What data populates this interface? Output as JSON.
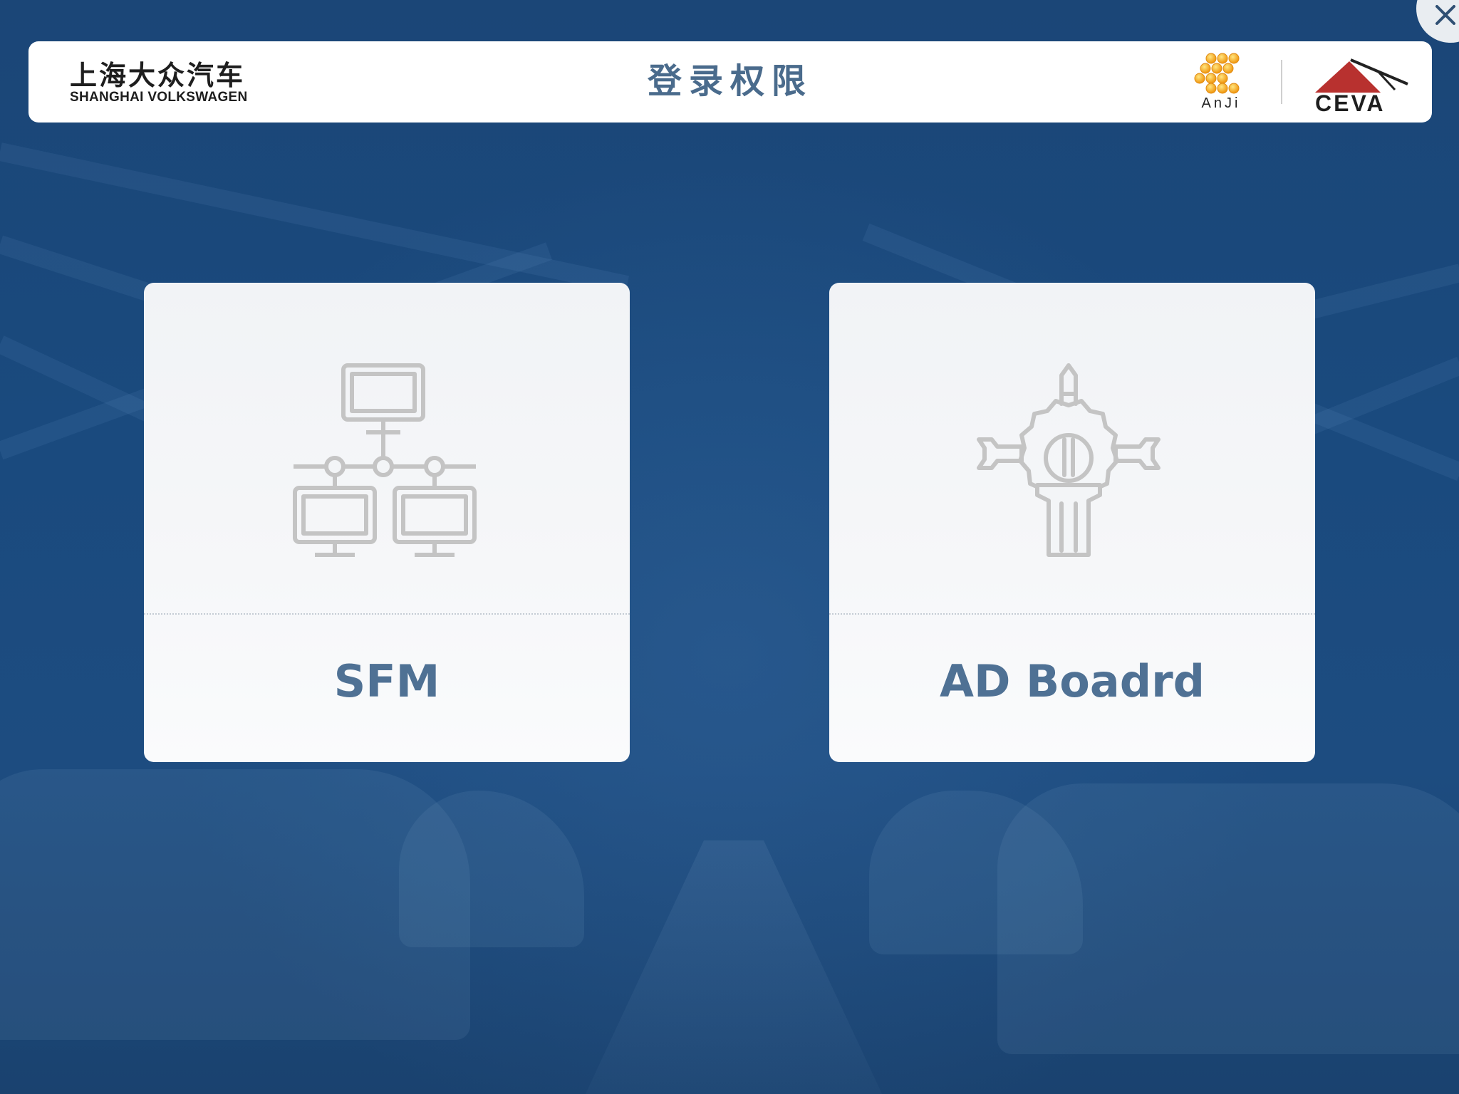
{
  "header": {
    "title": "登录权限",
    "brand_cn": "上海大众汽车",
    "brand_en": "SHANGHAI VOLKSWAGEN",
    "partner_logo_anji": "AnJi",
    "partner_logo_ceva": "CEVA"
  },
  "close_button": {
    "icon": "close-icon"
  },
  "options": [
    {
      "label": "SFM",
      "icon": "network-computers-icon"
    },
    {
      "label": "AD Boadrd",
      "icon": "tools-gear-icon"
    }
  ],
  "colors": {
    "background": "#1b4677",
    "card": "#f4f6f8",
    "label": "#4f7194",
    "title": "#4a6b8c",
    "icon": "#c4c4c4",
    "anji_dots": "#f2a51e",
    "ceva_red": "#b8312f"
  }
}
